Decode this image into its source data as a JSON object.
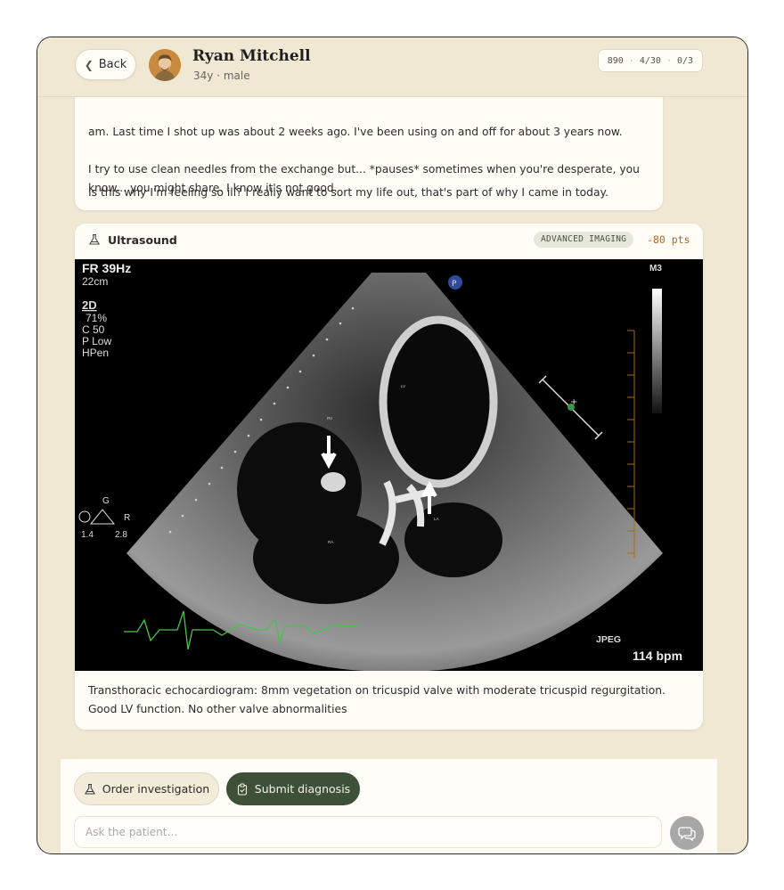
{
  "header": {
    "back_label": "Back",
    "patient_name": "Ryan Mitchell",
    "patient_sub": "34y · male",
    "stats": [
      "890",
      "4/30",
      "0/3"
    ]
  },
  "chat": {
    "partial_line": "am. Last time I shot up was about 2 weeks ago. I've been using on and off for about 3 years now.",
    "paragraph_2": "I try to use clean needles from the exchange but... *pauses* sometimes when you're desperate, you know... you might share. I know it's not good.",
    "paragraph_3": "Is this why I'm feeling so ill? I really want to sort my life out, that's part of why I came in today."
  },
  "investigation": {
    "title": "Ultrasound",
    "tag": "ADVANCED IMAGING",
    "points": "-80 pts",
    "image_overlay": {
      "fr": "FR 39Hz",
      "depth": "22cm",
      "mode": "2D",
      "gain": "71%",
      "c": "C 50",
      "power": "P Low",
      "hpen": "HPen",
      "m3": "M3",
      "jpeg": "JPEG",
      "bpm": "114 bpm",
      "g_label": "G",
      "r_label": "R",
      "p_label": "P",
      "v1": "1.4",
      "v2": "2.8",
      "lv": "LV",
      "rv": "RV",
      "ra": "RA",
      "la": "LA"
    },
    "caption": "Transthoracic echocardiogram: 8mm vegetation on tricuspid valve with moderate tricuspid regurgitation. Good LV function. No other valve abnormalities"
  },
  "actions": {
    "order_label": "Order investigation",
    "submit_label": "Submit diagnosis",
    "ask_placeholder": "Ask the patient…"
  },
  "colors": {
    "background": "#f0e8d2",
    "card": "#fffdf6",
    "primary": "#3d5138",
    "points": "#b8641d"
  }
}
